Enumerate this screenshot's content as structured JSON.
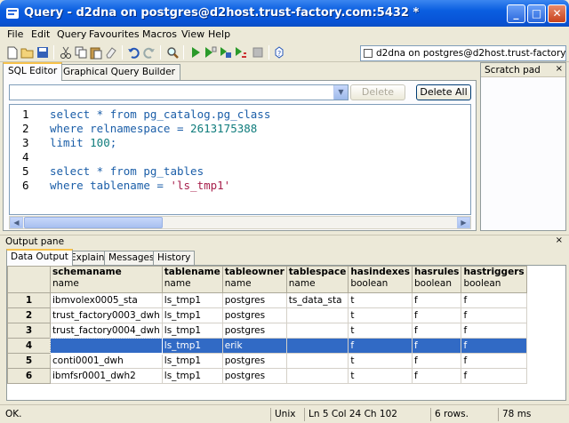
{
  "window": {
    "title": "Query - d2dna on postgres@d2host.trust-factory.com:5432 *",
    "min": "_",
    "max": "□",
    "close": "✕"
  },
  "menu": [
    "File",
    "Edit",
    "Query",
    "Favourites",
    "Macros",
    "View",
    "Help"
  ],
  "toolbar": {
    "icons": [
      "new-file-icon",
      "open-file-icon",
      "save-icon",
      "cut-icon",
      "copy-icon",
      "paste-icon",
      "clear-icon",
      "undo-icon",
      "redo-icon",
      "find-icon",
      "execute-icon",
      "execute-pgscript-icon",
      "execute-to-file-icon",
      "explain-icon",
      "stop-icon",
      "help-icon"
    ],
    "connection": "d2dna on postgres@d2host.trust-factory.co"
  },
  "editor": {
    "tabs": [
      "SQL Editor",
      "Graphical Query Builder"
    ],
    "delete_label": "Delete",
    "delete_all_label": "Delete All",
    "lines": [
      {
        "n": "1",
        "parts": [
          [
            "select * from pg_catalog.pg_class",
            ""
          ]
        ]
      },
      {
        "n": "2",
        "parts": [
          [
            "where relnamespace = ",
            ""
          ],
          [
            "2613175388",
            "n"
          ]
        ]
      },
      {
        "n": "3",
        "parts": [
          [
            "limit ",
            ""
          ],
          [
            "100",
            "n"
          ],
          [
            ";",
            ""
          ]
        ]
      },
      {
        "n": "4",
        "parts": [
          [
            "",
            ""
          ]
        ]
      },
      {
        "n": "5",
        "parts": [
          [
            "select * from pg_tables",
            ""
          ]
        ]
      },
      {
        "n": "6",
        "parts": [
          [
            "where tablename = ",
            ""
          ],
          [
            "'ls_tmp1'",
            "s"
          ]
        ]
      }
    ]
  },
  "scratch": {
    "title": "Scratch pad",
    "close": "×"
  },
  "output": {
    "title": "Output pane",
    "close": "×",
    "tabs": [
      "Data Output",
      "Explain",
      "Messages",
      "History"
    ],
    "columns": [
      {
        "name": "schemaname",
        "type": "name"
      },
      {
        "name": "tablename",
        "type": "name"
      },
      {
        "name": "tableowner",
        "type": "name"
      },
      {
        "name": "tablespace",
        "type": "name"
      },
      {
        "name": "hasindexes",
        "type": "boolean"
      },
      {
        "name": "hasrules",
        "type": "boolean"
      },
      {
        "name": "hastriggers",
        "type": "boolean"
      }
    ],
    "rows": [
      {
        "n": "1",
        "cells": [
          "ibmvolex0005_sta",
          "ls_tmp1",
          "postgres",
          "ts_data_sta",
          "t",
          "f",
          "f"
        ]
      },
      {
        "n": "2",
        "cells": [
          "trust_factory0003_dwh",
          "ls_tmp1",
          "postgres",
          "",
          "t",
          "f",
          "f"
        ]
      },
      {
        "n": "3",
        "cells": [
          "trust_factory0004_dwh",
          "ls_tmp1",
          "postgres",
          "",
          "t",
          "f",
          "f"
        ]
      },
      {
        "n": "4",
        "cells": [
          "",
          "ls_tmp1",
          "erik",
          "",
          "f",
          "f",
          "f"
        ]
      },
      {
        "n": "5",
        "cells": [
          "conti0001_dwh",
          "ls_tmp1",
          "postgres",
          "",
          "t",
          "f",
          "f"
        ]
      },
      {
        "n": "6",
        "cells": [
          "ibmfsr0001_dwh2",
          "ls_tmp1",
          "postgres",
          "",
          "t",
          "f",
          "f"
        ]
      }
    ],
    "selected_row": 3
  },
  "status": {
    "message": "OK.",
    "encoding": "Unix",
    "position": "Ln 5 Col 24 Ch 102",
    "rows": "6 rows.",
    "time": "78 ms"
  },
  "colors": {
    "title_blue": "#0853d6",
    "selection": "#316ac5",
    "keyword": "#1b5ea8",
    "string": "#a8214d",
    "number": "#0f7c7c"
  }
}
